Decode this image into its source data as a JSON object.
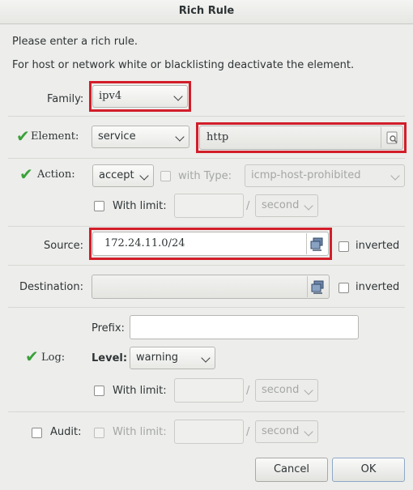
{
  "window": {
    "title": "Rich Rule"
  },
  "intro": {
    "line1": "Please enter a rich rule.",
    "line2": "For host or network white or blacklisting deactivate the element."
  },
  "family": {
    "label": "Family:",
    "value": "ipv4"
  },
  "element": {
    "label": "Element:",
    "type": "service",
    "value": "http"
  },
  "action": {
    "label": "Action:",
    "value": "accept",
    "with_type_label": "with Type:",
    "type_value": "icmp-host-prohibited",
    "with_limit_label": "With limit:",
    "slash": "/",
    "unit": "second"
  },
  "source": {
    "label": "Source:",
    "value": "172.24.11.0/24",
    "inverted_label": "inverted"
  },
  "destination": {
    "label": "Destination:",
    "value": "",
    "inverted_label": "inverted"
  },
  "log": {
    "label": "Log:",
    "prefix_label": "Prefix:",
    "prefix_value": "",
    "level_label": "Level:",
    "level_value": "warning",
    "with_limit_label": "With limit:",
    "slash": "/",
    "unit": "second"
  },
  "audit": {
    "label": "Audit:",
    "with_limit_label": "With limit:",
    "slash": "/",
    "unit": "second"
  },
  "buttons": {
    "cancel": "Cancel",
    "ok": "OK"
  },
  "colors": {
    "highlight": "#d21e2a",
    "check": "#3aa13a"
  }
}
